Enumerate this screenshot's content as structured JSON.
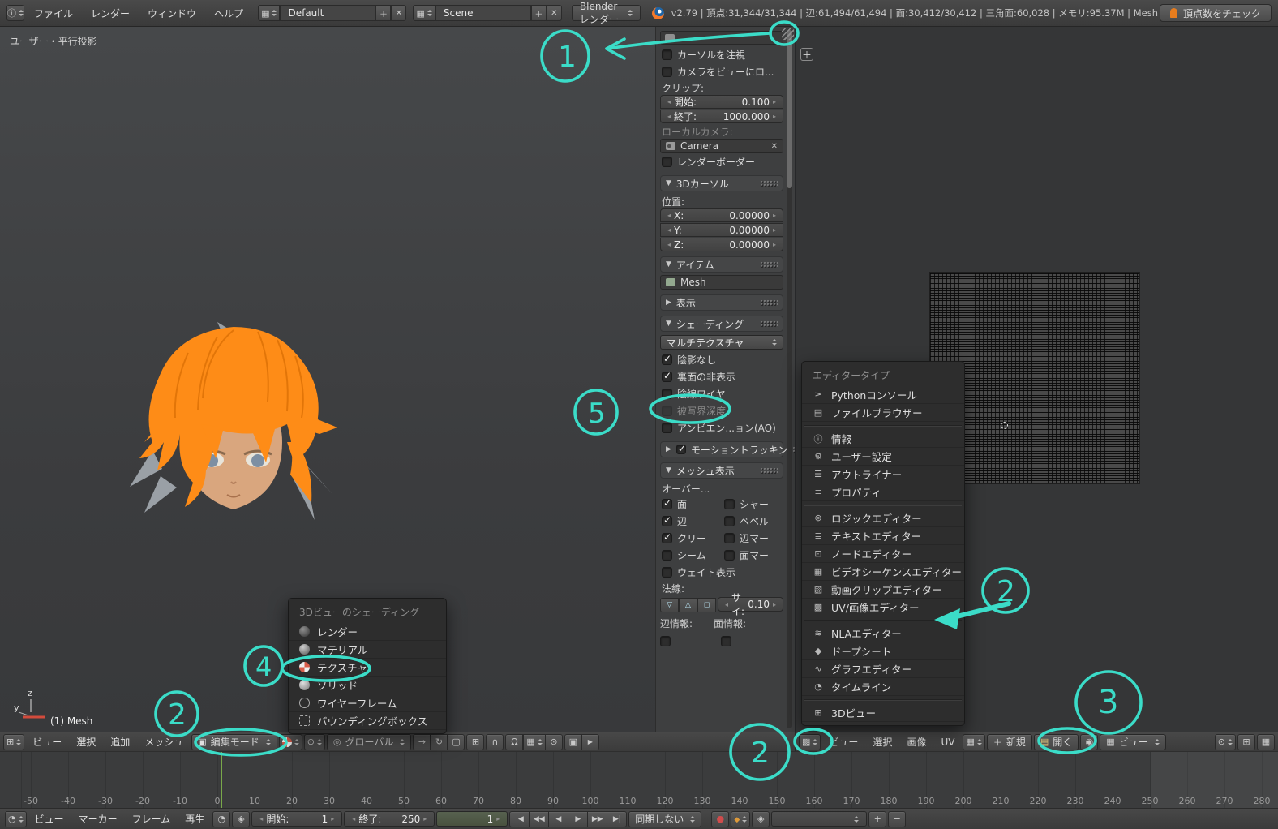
{
  "topbar": {
    "menu_file": "ファイル",
    "menu_render": "レンダー",
    "menu_window": "ウィンドウ",
    "menu_help": "ヘルプ",
    "screen_value": "Default",
    "scene_value": "Scene",
    "engine_value": "Blenderレンダー",
    "stats": "v2.79 | 頂点:31,344/31,344 | 辺:61,494/61,494 | 面:30,412/30,412 | 三角面:60,028 | メモリ:95.37M | Mesh",
    "check_button": "頂点数をチェック"
  },
  "viewport": {
    "view_label": "ユーザー・平行投影",
    "object_label": "(1) Mesh",
    "axis_z": "z",
    "axis_y": "y"
  },
  "npanel": {
    "lock_cursor": "カーソルを注視",
    "lock_camera": "カメラをビューにロ...",
    "clip_label": "クリップ:",
    "clip_start_label": "開始:",
    "clip_start_value": "0.100",
    "clip_end_label": "終了:",
    "clip_end_value": "1000.000",
    "local_camera_label": "ローカルカメラ:",
    "camera_value": "Camera",
    "render_border": "レンダーボーダー",
    "cursor_title": "3Dカーソル",
    "pos_label": "位置:",
    "x_label": "X:",
    "x_value": "0.00000",
    "y_label": "Y:",
    "y_value": "0.00000",
    "z_label": "Z:",
    "z_value": "0.00000",
    "item_title": "アイテム",
    "item_name": "Mesh",
    "display_title": "表示",
    "shading_title": "シェーディング",
    "shading_mode": "マルチテクスチャ",
    "shading_options": [
      {
        "label": "陰影なし",
        "checked": true
      },
      {
        "label": "裏面の非表示",
        "checked": true
      },
      {
        "label": "陰線ワイヤ"
      },
      {
        "label": "被写界深度",
        "disabled": true
      },
      {
        "label": "アンビエン...ョン(AO)"
      }
    ],
    "motion_title": "モーショントラッキン",
    "mesh_title": "メッシュ表示",
    "overlays_label": "オーバー...",
    "mesh_checks": [
      {
        "label": "面",
        "checked": true
      },
      {
        "label": "シャー"
      },
      {
        "label": "辺",
        "checked": true
      },
      {
        "label": "ベベル"
      },
      {
        "label": "クリー",
        "checked": true
      },
      {
        "label": "辺マー"
      },
      {
        "label": "シーム"
      },
      {
        "label": "面マー"
      }
    ],
    "weight_label": "ウェイト表示",
    "normals_label": "法線:",
    "size_label": "サイ:",
    "size_value": "0.10",
    "edge_info_label": "辺情報:",
    "face_info_label": "面情報:"
  },
  "editor_menu": {
    "title": "エディタータイプ",
    "items": [
      {
        "label": "Pythonコンソール",
        "icon": "console"
      },
      {
        "label": "ファイルブラウザー",
        "icon": "filebrowser"
      },
      {
        "sep": true
      },
      {
        "label": "情報",
        "icon": "info"
      },
      {
        "label": "ユーザー設定",
        "icon": "prefs"
      },
      {
        "label": "アウトライナー",
        "icon": "outliner"
      },
      {
        "label": "プロパティ",
        "icon": "properties"
      },
      {
        "sep": true
      },
      {
        "label": "ロジックエディター",
        "icon": "logic"
      },
      {
        "label": "テキストエディター",
        "icon": "text"
      },
      {
        "label": "ノードエディター",
        "icon": "node"
      },
      {
        "label": "ビデオシーケンスエディター",
        "icon": "sequencer"
      },
      {
        "label": "動画クリップエディター",
        "icon": "clip"
      },
      {
        "label": "UV/画像エディター",
        "icon": "uv"
      },
      {
        "sep": true
      },
      {
        "label": "NLAエディター",
        "icon": "nla"
      },
      {
        "label": "ドープシート",
        "icon": "dopesheet"
      },
      {
        "label": "グラフエディター",
        "icon": "graph"
      },
      {
        "label": "タイムライン",
        "icon": "timeline"
      },
      {
        "sep": true
      },
      {
        "label": "3Dビュー",
        "icon": "view3d"
      }
    ]
  },
  "shading_menu": {
    "title": "3Dビューのシェーディング",
    "items": [
      {
        "label": "レンダー",
        "icon": "render"
      },
      {
        "label": "マテリアル",
        "icon": "material"
      },
      {
        "label": "テクスチャ",
        "icon": "texture"
      },
      {
        "label": "ソリッド",
        "icon": "solid"
      },
      {
        "label": "ワイヤーフレーム",
        "icon": "wire"
      },
      {
        "label": "バウンディングボックス",
        "icon": "bbox"
      }
    ]
  },
  "view3d_header": {
    "menu_view": "ビュー",
    "menu_select": "選択",
    "menu_add": "追加",
    "menu_mesh": "メッシュ",
    "mode": "編集モード",
    "orientation": "グローバル"
  },
  "uv_header": {
    "menu_view": "ビュー",
    "menu_select": "選択",
    "menu_image": "画像",
    "menu_uv": "UV",
    "new_button": "新規",
    "open_button": "開く",
    "view_dropdown": "ビュー"
  },
  "timeline": {
    "ruler": [
      -50,
      -40,
      -30,
      -20,
      -10,
      0,
      10,
      20,
      30,
      40,
      50,
      60,
      70,
      80,
      90,
      100,
      110,
      120,
      130,
      140,
      150,
      160,
      170,
      180,
      190,
      200,
      210,
      220,
      230,
      240,
      250,
      260,
      270,
      280
    ],
    "menu_view": "ビュー",
    "menu_marker": "マーカー",
    "menu_frame": "フレーム",
    "menu_play": "再生",
    "start_label": "開始:",
    "start_value": "1",
    "end_label": "終了:",
    "end_value": "250",
    "current_value": "1",
    "playback": [
      "|◀",
      "◀◀",
      "◀",
      "▶",
      "▶▶",
      "▶|"
    ],
    "sync": "同期しない"
  },
  "annotations": {
    "color": "#3bdcc8",
    "n1": "1",
    "n2": "2",
    "n3": "3",
    "n4": "4",
    "n5": "5"
  }
}
